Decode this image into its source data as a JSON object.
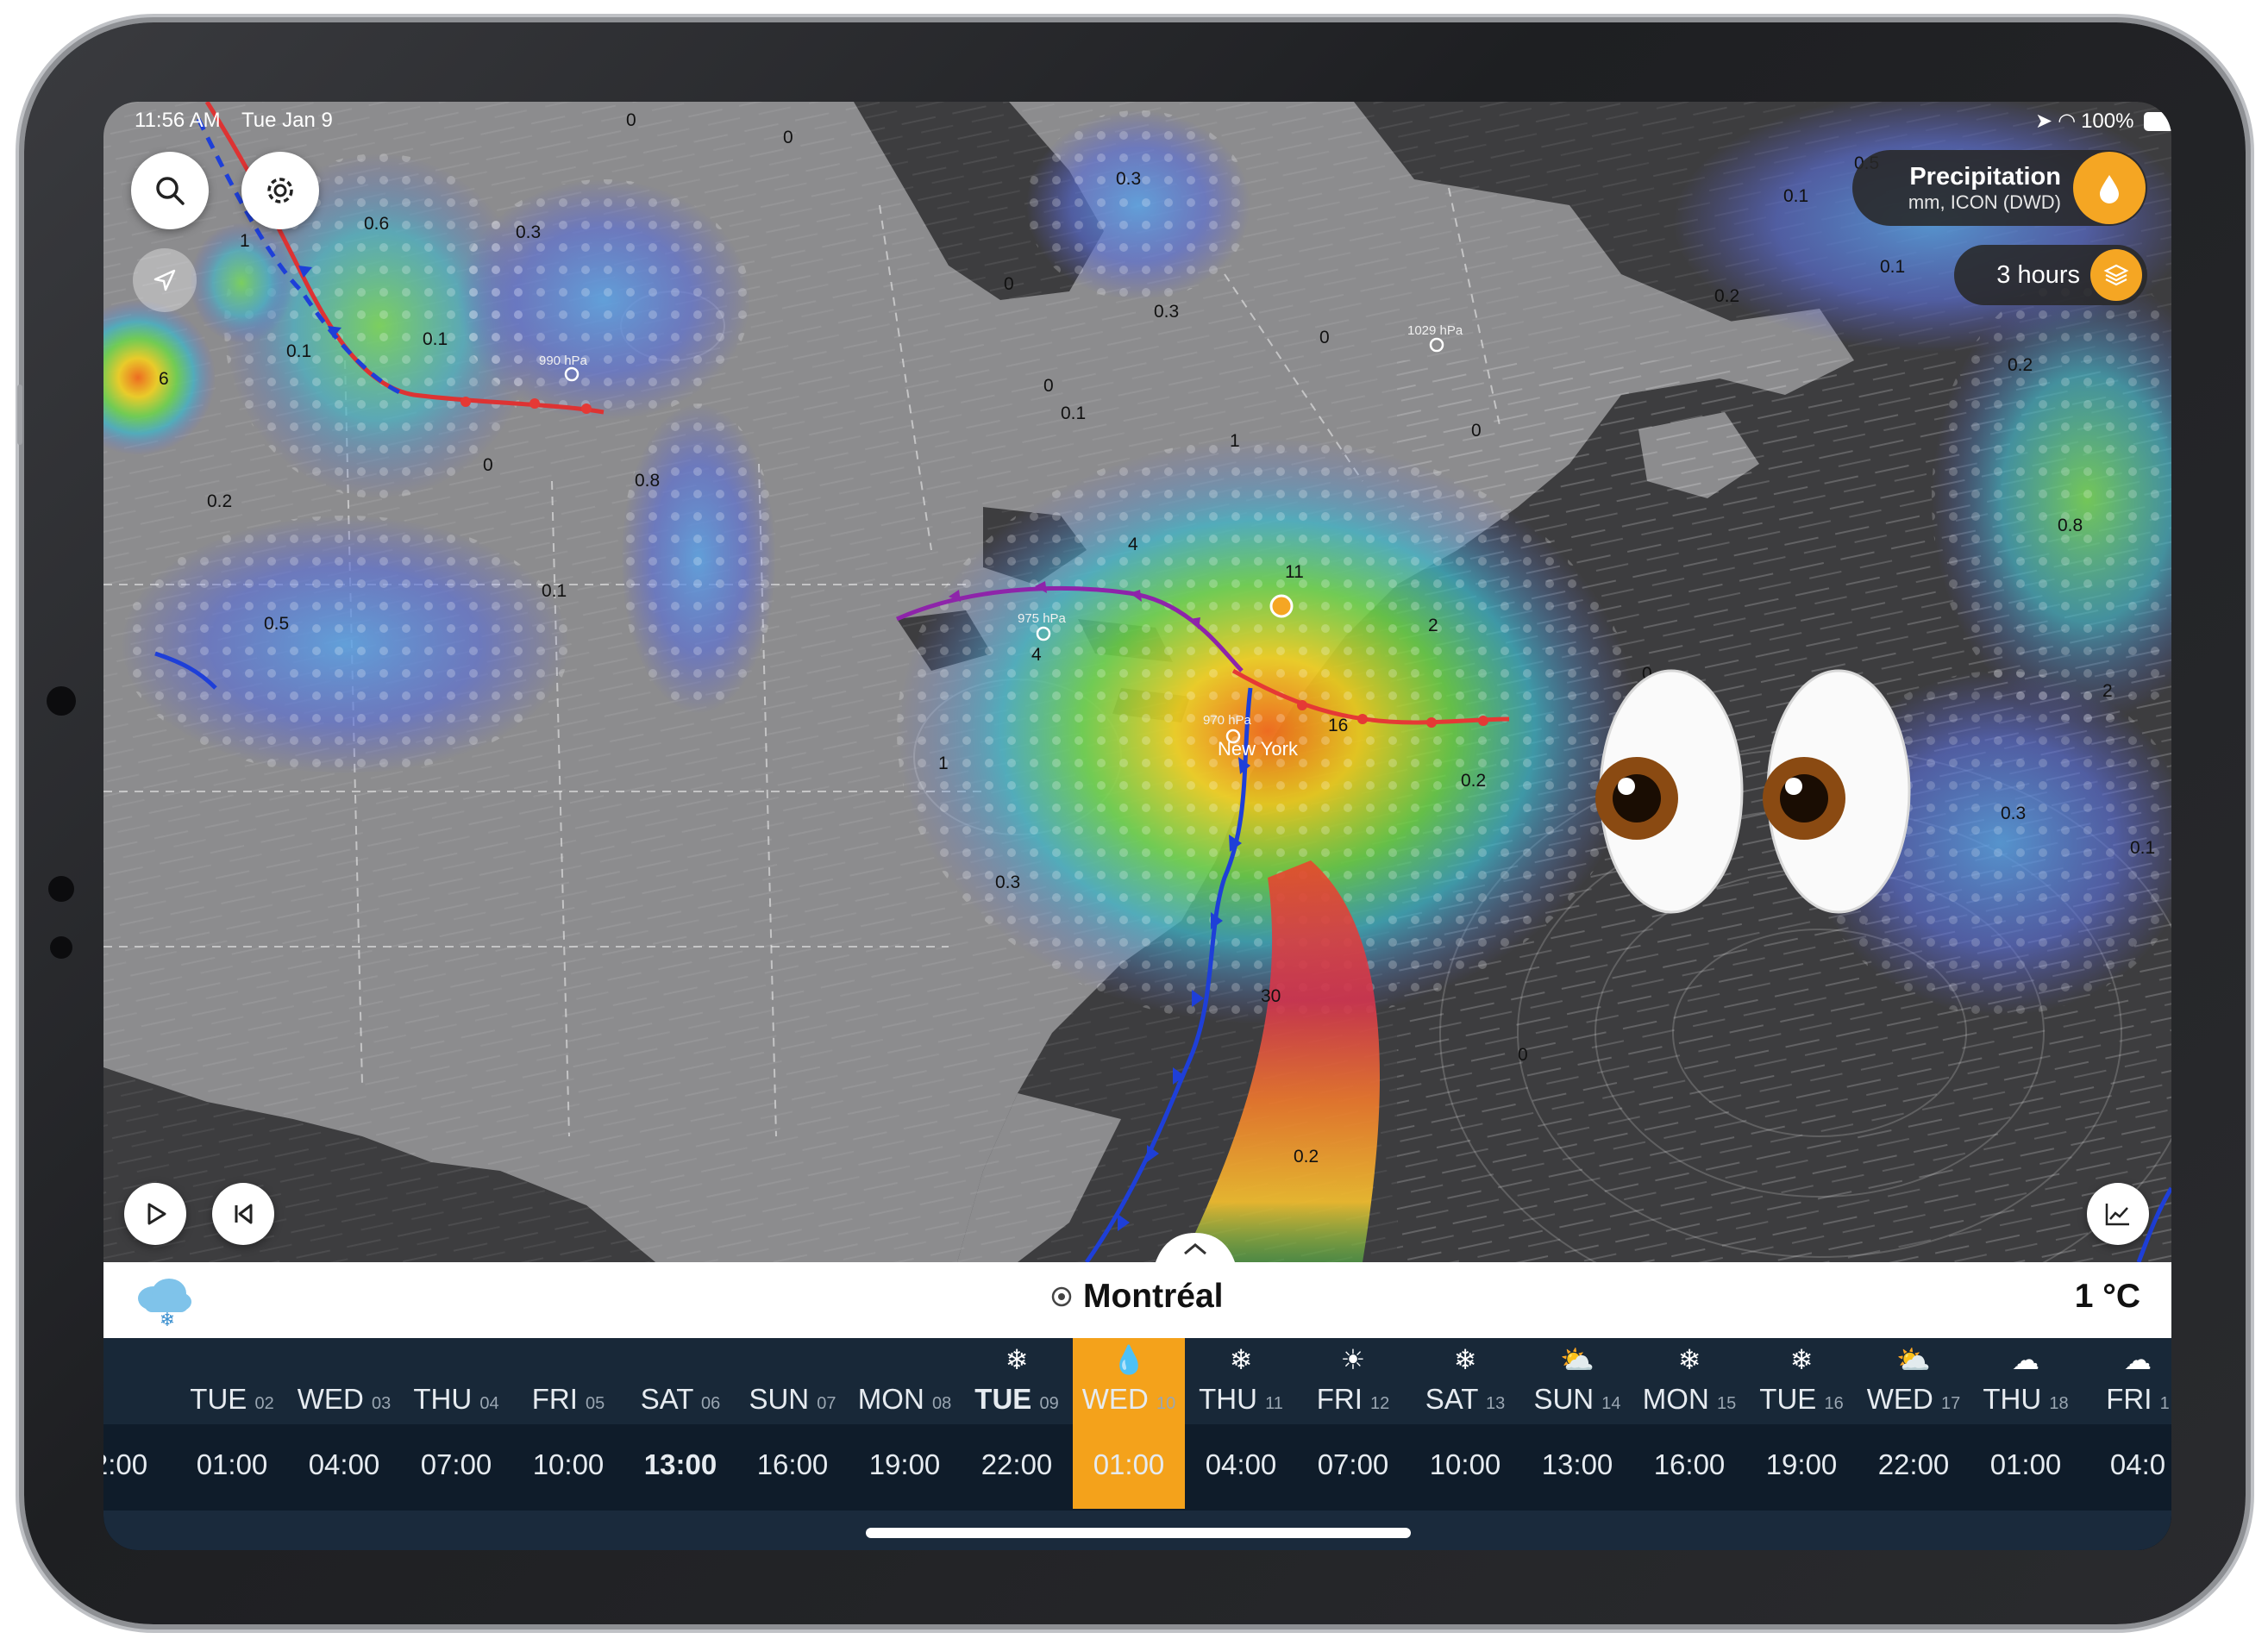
{
  "status_bar": {
    "time": "11:56 AM",
    "date": "Tue Jan 9",
    "battery": "100%"
  },
  "controls": {
    "search_icon": "search-icon",
    "settings_icon": "gear-icon",
    "locate_icon": "location-arrow-icon",
    "play_icon": "play-icon",
    "rewind_icon": "skip-back-icon",
    "chart_icon": "chart-icon"
  },
  "layer_pill": {
    "title": "Precipitation",
    "subtitle": "mm, ICON (DWD)",
    "icon": "raindrop-icon"
  },
  "interval_pill": {
    "label": "3 hours",
    "icon": "layers-icon"
  },
  "map": {
    "city_label": "New York",
    "pressure_labels": [
      "990 hPa",
      "1029 hPa",
      "975 hPa",
      "970 hPa"
    ],
    "precip_values": [
      "0",
      "0.6",
      "0.3",
      "0",
      "1",
      "0.1",
      "6",
      "0.1",
      "0.2",
      "0.5",
      "0.1",
      "0.8",
      "0",
      "0",
      "0",
      "0.3",
      "0.3",
      "0",
      "0.1",
      "1",
      "4",
      "11",
      "4",
      "2",
      "0",
      "16",
      "0.2",
      "0.3",
      "1",
      "30",
      "0.2",
      "0.1",
      "0.5",
      "0.1",
      "0.2",
      "0.2",
      "0.8",
      "2",
      "0.3",
      "0.1",
      "0",
      "0"
    ],
    "colors": {
      "land": "#8c8c8c",
      "water": "#3c3c3c",
      "warm_front": "#e53935",
      "cold_front": "#1e3fd8",
      "occluded_front": "#8e24aa"
    }
  },
  "location_bar": {
    "place": "Montréal",
    "temperature": "1 °C",
    "weather_icon": "cloud-snow-icon",
    "pin_icon": "location-target-icon",
    "chevron_icon": "chevron-up-icon"
  },
  "timeline": {
    "days": [
      {
        "day": "",
        "date": "",
        "icon": "",
        "time": "2:00"
      },
      {
        "day": "TUE",
        "date": "02",
        "icon": "",
        "time": "01:00"
      },
      {
        "day": "WED",
        "date": "03",
        "icon": "",
        "time": "04:00"
      },
      {
        "day": "THU",
        "date": "04",
        "icon": "",
        "time": "07:00"
      },
      {
        "day": "FRI",
        "date": "05",
        "icon": "",
        "time": "10:00"
      },
      {
        "day": "SAT",
        "date": "06",
        "icon": "",
        "time": "13:00"
      },
      {
        "day": "SUN",
        "date": "07",
        "icon": "",
        "time": "16:00"
      },
      {
        "day": "MON",
        "date": "08",
        "icon": "",
        "time": "19:00"
      },
      {
        "day": "TUE",
        "date": "09",
        "icon": "❄",
        "time": "22:00"
      },
      {
        "day": "WED",
        "date": "10",
        "icon": "💧",
        "time": "01:00"
      },
      {
        "day": "THU",
        "date": "11",
        "icon": "❄",
        "time": "04:00"
      },
      {
        "day": "FRI",
        "date": "12",
        "icon": "☀",
        "time": "07:00"
      },
      {
        "day": "SAT",
        "date": "13",
        "icon": "❄",
        "time": "10:00"
      },
      {
        "day": "SUN",
        "date": "14",
        "icon": "⛅",
        "time": "13:00"
      },
      {
        "day": "MON",
        "date": "15",
        "icon": "❄",
        "time": "16:00"
      },
      {
        "day": "TUE",
        "date": "16",
        "icon": "❄",
        "time": "19:00"
      },
      {
        "day": "WED",
        "date": "17",
        "icon": "⛅",
        "time": "22:00"
      },
      {
        "day": "THU",
        "date": "18",
        "icon": "☁",
        "time": "01:00"
      },
      {
        "day": "FRI",
        "date": "1",
        "icon": "☁",
        "time": "04:0"
      }
    ],
    "selected_index": 9,
    "bold_day_index": 8,
    "bold_time_index": 5
  }
}
